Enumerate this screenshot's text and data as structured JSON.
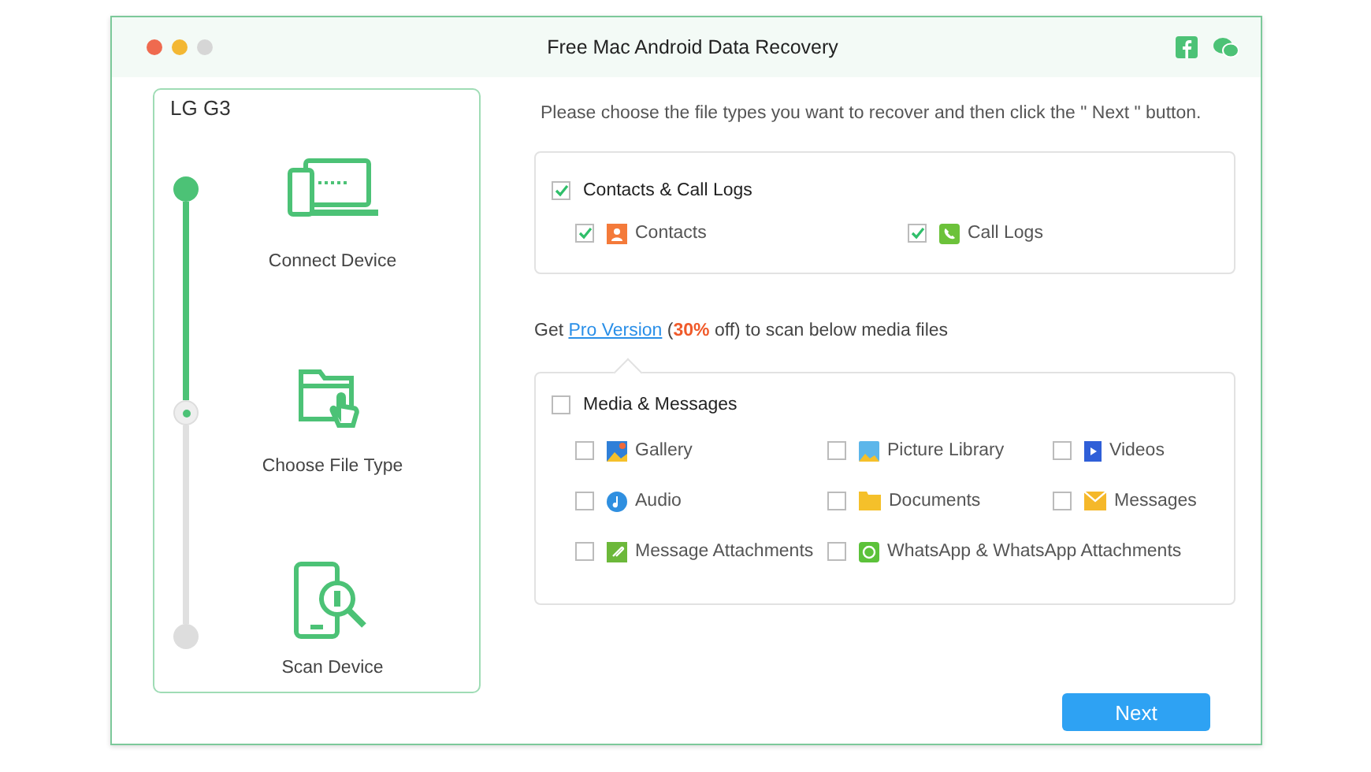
{
  "window": {
    "title": "Free Mac Android Data Recovery"
  },
  "device": {
    "name": "LG G3"
  },
  "steps": [
    {
      "label": "Connect Device",
      "kind": "connect",
      "done": true,
      "selected": false
    },
    {
      "label": "Choose File Type",
      "kind": "choose",
      "done": false,
      "selected": true
    },
    {
      "label": "Scan Device",
      "kind": "scan",
      "done": false,
      "selected": false
    }
  ],
  "instruction": "Please choose the file types you want to recover and then click the \" Next \" button.",
  "groups": [
    {
      "title": "Contacts & Call Logs",
      "checked": true,
      "items": [
        {
          "label": "Contacts",
          "kind": "contacts",
          "checked": true
        },
        {
          "label": "Call Logs",
          "kind": "calllogs",
          "checked": true
        }
      ]
    },
    {
      "title": "Media & Messages",
      "checked": false,
      "items": [
        {
          "label": "Gallery",
          "kind": "gallery",
          "checked": false
        },
        {
          "label": "Picture Library",
          "kind": "picturelibrary",
          "checked": false
        },
        {
          "label": "Videos",
          "kind": "videos",
          "checked": false
        },
        {
          "label": "Audio",
          "kind": "audio",
          "checked": false
        },
        {
          "label": "Documents",
          "kind": "documents",
          "checked": false
        },
        {
          "label": "Messages",
          "kind": "messages",
          "checked": false
        },
        {
          "label": "Message Attachments",
          "kind": "attachments",
          "checked": false
        },
        {
          "label": "WhatsApp & WhatsApp Attachments",
          "kind": "whatsapp",
          "checked": false
        }
      ]
    }
  ],
  "promo": {
    "before": "Get ",
    "link": "Pro Version",
    "middle": " (",
    "discount": "30%",
    "after": " off) to scan below media files"
  },
  "buttons": {
    "next": "Next"
  }
}
